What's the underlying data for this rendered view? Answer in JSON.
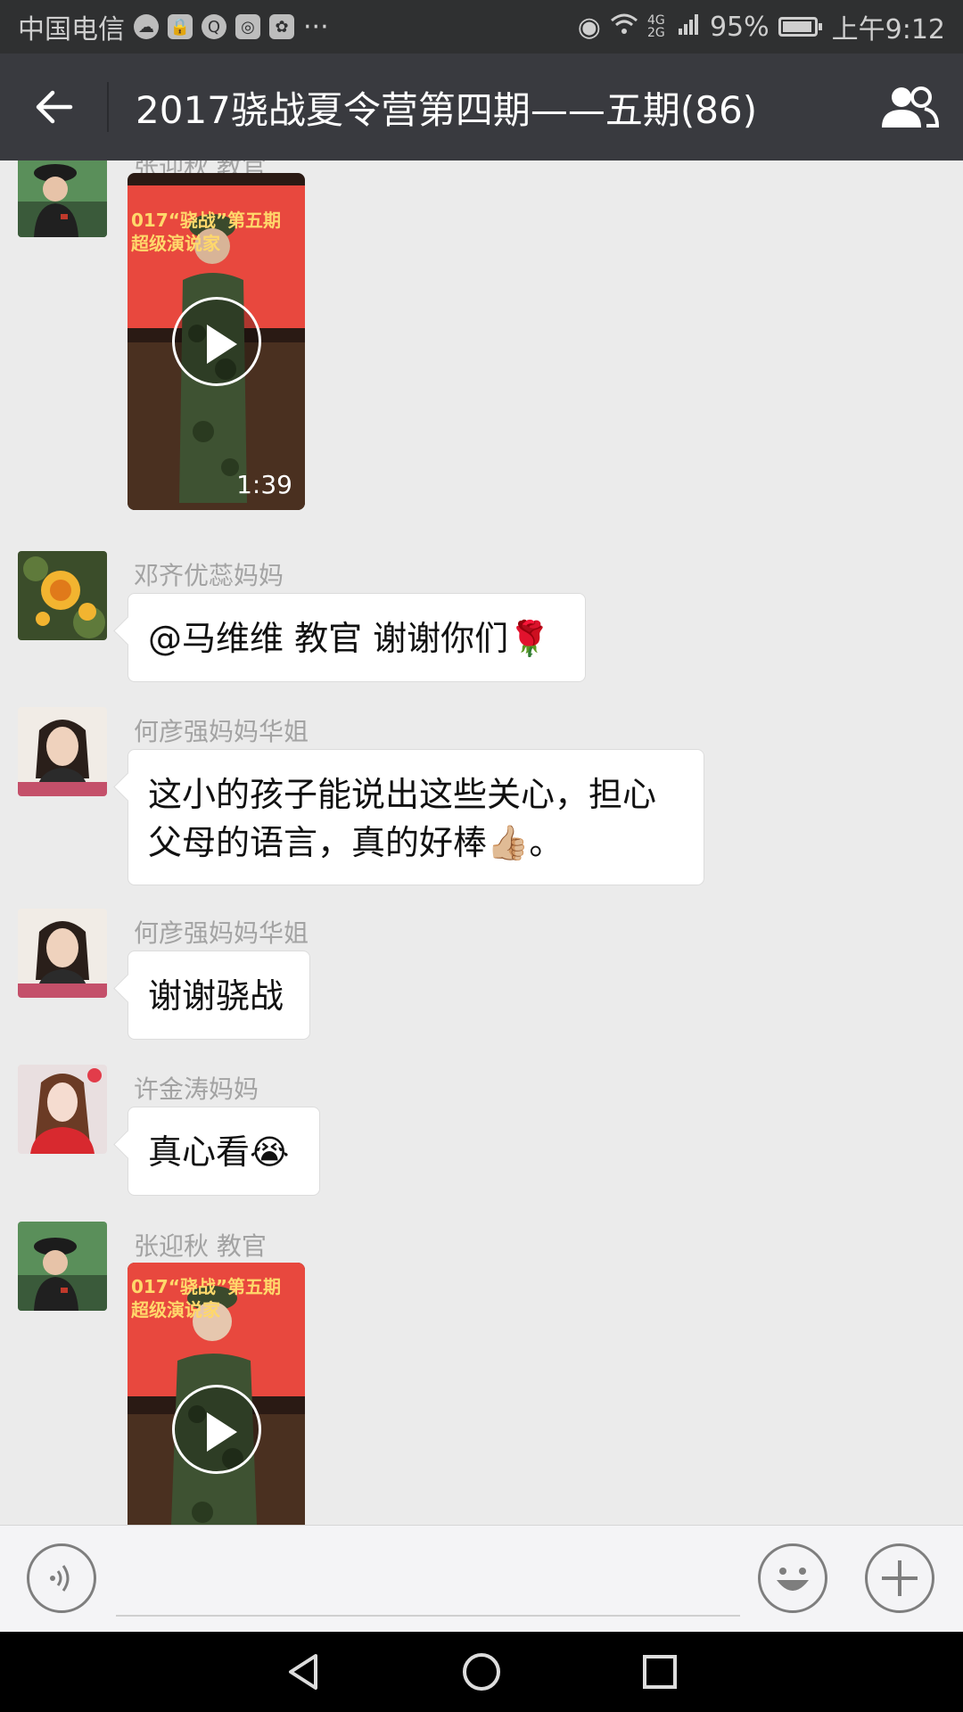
{
  "status_bar": {
    "carrier": "中国电信",
    "more": "···",
    "network": "4G 2G",
    "battery_percent": "95%",
    "battery_level": 0.95,
    "time": "上午9:12"
  },
  "header": {
    "title": "2017骁战夏令营第四期——五期(86)",
    "back_icon": "arrow-left-icon",
    "group_icon": "group-members-icon"
  },
  "messages": [
    {
      "sender": "张迎秋 教官",
      "type": "video",
      "duration": "1:39",
      "banner_text": "017“骁战”第五期 超级演说家"
    },
    {
      "sender": "邓齐优蕊妈妈",
      "type": "text",
      "text": "@马维维 教官 谢谢你们🌹"
    },
    {
      "sender": "何彦强妈妈华姐",
      "type": "text",
      "text": "这小的孩子能说出这些关心，担心父母的语言，真的好棒👍🏼。"
    },
    {
      "sender": "何彦强妈妈华姐",
      "type": "text",
      "text": "谢谢骁战"
    },
    {
      "sender": "许金涛妈妈",
      "type": "text",
      "text": "真心看😭"
    },
    {
      "sender": "张迎秋 教官",
      "type": "video",
      "duration": "",
      "banner_text": "017“骁战”第五期 超级演说家"
    }
  ],
  "input_bar": {
    "voice_icon": "voice-input-icon",
    "emoji_icon": "emoji-icon",
    "plus_icon": "plus-icon",
    "input_value": ""
  },
  "colors": {
    "status_bg": "#2f3031",
    "header_bg": "#393a3f",
    "chat_bg": "#ebebeb",
    "bubble_bg": "#ffffff"
  }
}
